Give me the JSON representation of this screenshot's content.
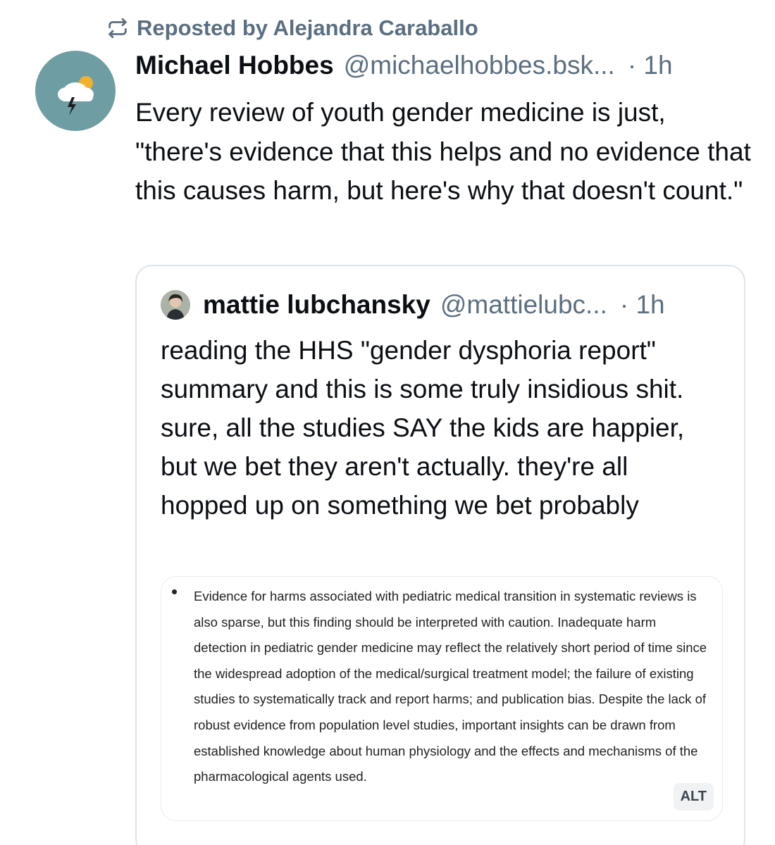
{
  "repost": {
    "icon": "repost-icon",
    "label": "Reposted by Alejandra Caraballo"
  },
  "post": {
    "avatar_icon": "storm-cloud-icon",
    "display_name": "Michael Hobbes",
    "handle": "@michaelhobbes.bsk...",
    "timestamp": "· 1h",
    "text": "Every review of youth gender medicine is just, \"there's evidence that this helps and no evidence that this causes harm, but here's why that doesn't count.\""
  },
  "quote": {
    "display_name": "mattie lubchansky",
    "handle": "@mattielubc...",
    "timestamp": "· 1h",
    "text": "reading the HHS \"gender dysphoria report\" summary and this is some truly insidious shit. sure, all the studies SAY the kids are happier, but we bet they aren't actually. they're all hopped up on something we bet probably",
    "image": {
      "bullet": "•",
      "text": "Evidence for harms associated with pediatric medical transition in systematic reviews is also sparse, but this finding should be interpreted with caution. Inadequate harm detection in pediatric gender medicine may reflect the relatively short period of time since the widespread adoption of the medical/surgical treatment model; the failure of existing studies to systematically track and report harms; and publication bias. Despite the lack of robust evidence from population level studies, important insights can be drawn from established knowledge about human physiology and the effects and mechanisms of the pharmacological agents used.",
      "alt_label": "ALT"
    }
  },
  "colors": {
    "muted": "#5b6f82",
    "text": "#0b0f14",
    "border": "#dfe4ea",
    "avatar_bg": "#6e9ea4"
  }
}
